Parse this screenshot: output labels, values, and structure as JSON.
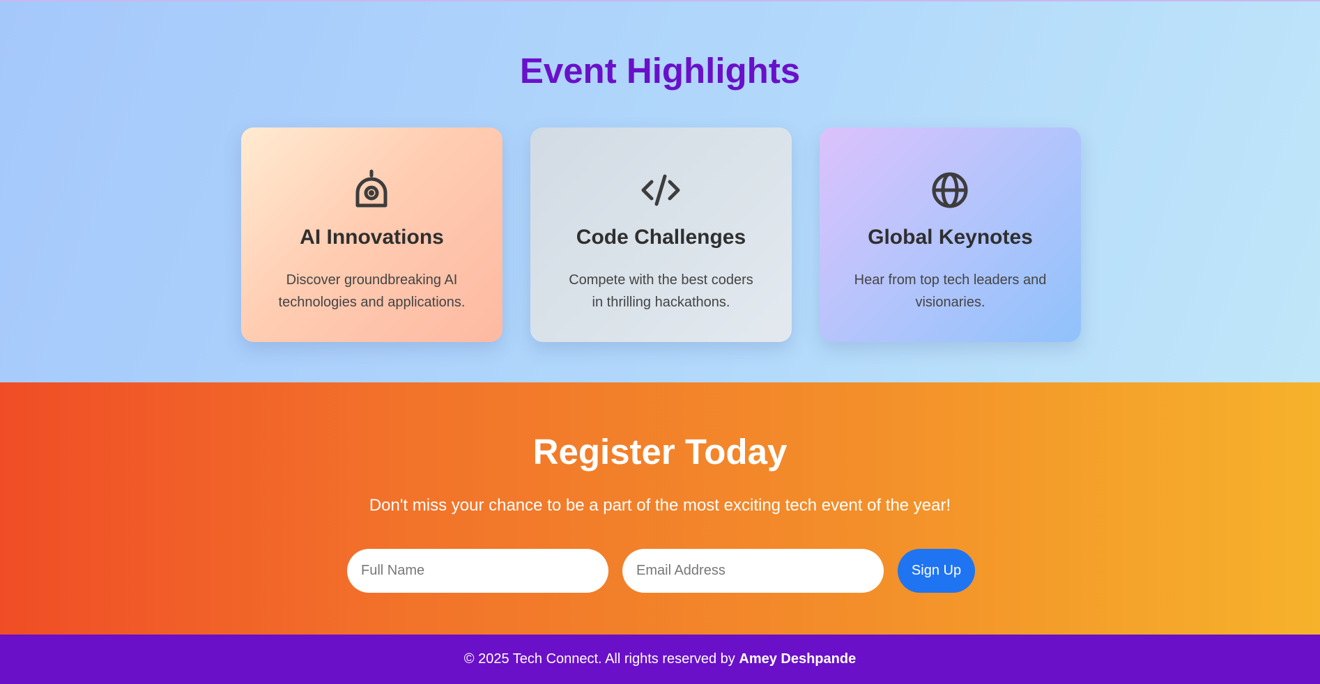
{
  "highlights": {
    "title": "Event Highlights",
    "cards": [
      {
        "icon": "robot-icon",
        "title": "AI Innovations",
        "description": "Discover groundbreaking AI technologies and applications."
      },
      {
        "icon": "code-icon",
        "title": "Code Challenges",
        "description": "Compete with the best coders in thrilling hackathons."
      },
      {
        "icon": "globe-icon",
        "title": "Global Keynotes",
        "description": "Hear from top tech leaders and visionaries."
      }
    ]
  },
  "register": {
    "title": "Register Today",
    "subtitle": "Don't miss your chance to be a part of the most exciting tech event of the year!",
    "name_placeholder": "Full Name",
    "email_placeholder": "Email Address",
    "signup_label": "Sign Up"
  },
  "footer": {
    "text": "© 2025 Tech Connect. All rights reserved by ",
    "author": "Amey Deshpande"
  },
  "colors": {
    "accent_purple": "#6a10c9",
    "signup_blue": "#1f74f2",
    "register_gradient_start": "#f04d26",
    "register_gradient_end": "#f6b22b",
    "icon_color": "#3d3d3d"
  }
}
